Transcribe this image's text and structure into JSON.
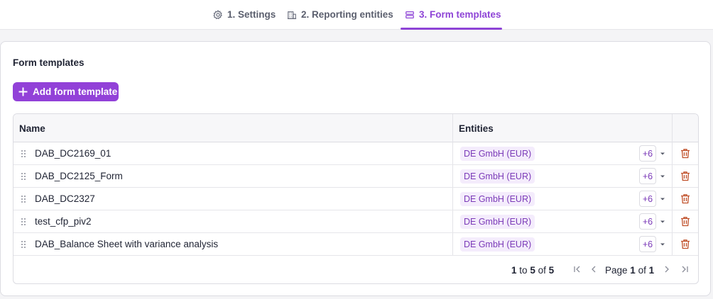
{
  "tabs": [
    {
      "label": "1. Settings",
      "icon": "gear-icon"
    },
    {
      "label": "2. Reporting entities",
      "icon": "building-icon"
    },
    {
      "label": "3. Form templates",
      "icon": "form-template-icon",
      "active": true
    }
  ],
  "card": {
    "title": "Form templates",
    "add_button_label": "Add form template"
  },
  "table": {
    "columns": [
      "Name",
      "Entities"
    ],
    "rows": [
      {
        "name": "DAB_DC2169_01",
        "entity": "DE GmbH (EUR)",
        "more": "+6"
      },
      {
        "name": "DAB_DC2125_Form",
        "entity": "DE GmbH (EUR)",
        "more": "+6"
      },
      {
        "name": "DAB_DC2327",
        "entity": "DE GmbH (EUR)",
        "more": "+6"
      },
      {
        "name": "test_cfp_piv2",
        "entity": "DE GmbH (EUR)",
        "more": "+6"
      },
      {
        "name": "DAB_Balance Sheet with variance analysis",
        "entity": "DE GmbH (EUR)",
        "more": "+6"
      }
    ]
  },
  "pagination": {
    "range_from": "1",
    "range_to_word": "to",
    "range_to": "5",
    "of_word": "of",
    "total": "5",
    "page_word": "Page",
    "page_current": "1",
    "page_total": "1"
  },
  "colors": {
    "accent": "#9241d8",
    "chip_bg": "#f4ecfc",
    "delete": "#c0502a"
  }
}
